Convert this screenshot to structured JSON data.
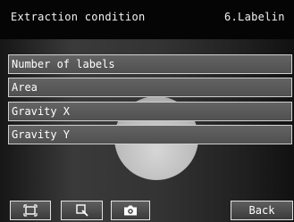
{
  "header": {
    "title": "Extraction condition",
    "step": "6.Labelin"
  },
  "list": {
    "items": [
      {
        "label": "Number of labels"
      },
      {
        "label": "Area"
      },
      {
        "label": "Gravity X"
      },
      {
        "label": "Gravity Y"
      }
    ]
  },
  "toolbar": {
    "fit_icon": "fit-frame-icon",
    "zoom_icon": "zoom-icon",
    "camera_icon": "camera-icon",
    "back_label": "Back"
  },
  "colors": {
    "header_bg": "#050505",
    "item_bg": "#5a5a5a",
    "item_border": "#d0d0d0",
    "text": "#ffffff"
  }
}
